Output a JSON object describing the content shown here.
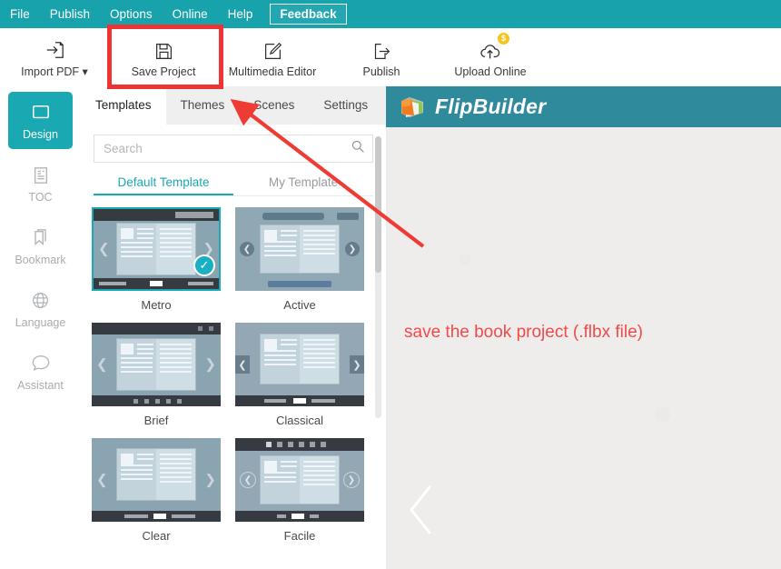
{
  "menubar": {
    "items": [
      {
        "label": "File",
        "name": "menu-file"
      },
      {
        "label": "Publish",
        "name": "menu-publish"
      },
      {
        "label": "Options",
        "name": "menu-options"
      },
      {
        "label": "Online",
        "name": "menu-online"
      },
      {
        "label": "Help",
        "name": "menu-help"
      }
    ],
    "feedback_label": "Feedback",
    "background_color": "#17a2ac"
  },
  "toolbar": {
    "items": [
      {
        "label": "Import PDF ▾",
        "icon": "import-pdf-icon"
      },
      {
        "label": "Save Project",
        "icon": "save-floppy-icon"
      },
      {
        "label": "Multimedia Editor",
        "icon": "pencil-square-icon"
      },
      {
        "label": "Publish",
        "icon": "publish-export-icon"
      },
      {
        "label": "Upload Online",
        "icon": "cloud-upload-icon",
        "badge": "$"
      }
    ]
  },
  "sidebar": {
    "items": [
      {
        "label": "Design",
        "icon": "design-frame-icon",
        "active": true
      },
      {
        "label": "TOC",
        "icon": "toc-document-icon",
        "active": false
      },
      {
        "label": "Bookmark",
        "icon": "bookmark-icon",
        "active": false
      },
      {
        "label": "Language",
        "icon": "globe-icon",
        "active": false
      },
      {
        "label": "Assistant",
        "icon": "chat-bubble-icon",
        "active": false
      }
    ],
    "active_color": "#1aa9b3"
  },
  "panel": {
    "tabs": [
      {
        "label": "Templates",
        "active": true
      },
      {
        "label": "Themes",
        "active": false
      },
      {
        "label": "Scenes",
        "active": false
      },
      {
        "label": "Settings",
        "active": false
      }
    ],
    "search": {
      "value": "",
      "placeholder": "Search",
      "icon": "search-icon"
    },
    "subtabs": [
      {
        "label": "Default Template",
        "active": true
      },
      {
        "label": "My Template",
        "active": false
      }
    ],
    "templates": [
      {
        "name": "Metro",
        "selected": true
      },
      {
        "name": "Active",
        "selected": false
      },
      {
        "name": "Brief",
        "selected": false
      },
      {
        "name": "Classical",
        "selected": false
      },
      {
        "name": "Clear",
        "selected": false
      },
      {
        "name": "Facile",
        "selected": false
      }
    ],
    "selected_check_icon": "check-icon",
    "accent_color": "#1aa9b3"
  },
  "preview": {
    "brand_title": "FlipBuilder",
    "header_color": "#2f8a9b",
    "prev_page_icon": "chevron-left-icon"
  },
  "annotation": {
    "text": "save the book project (.flbx file)",
    "color": "#ef4b4b",
    "highlight_target": "Save Project",
    "highlight_color": "#ee3333",
    "arrow_from": "465,270",
    "arrow_to": "252,108"
  }
}
